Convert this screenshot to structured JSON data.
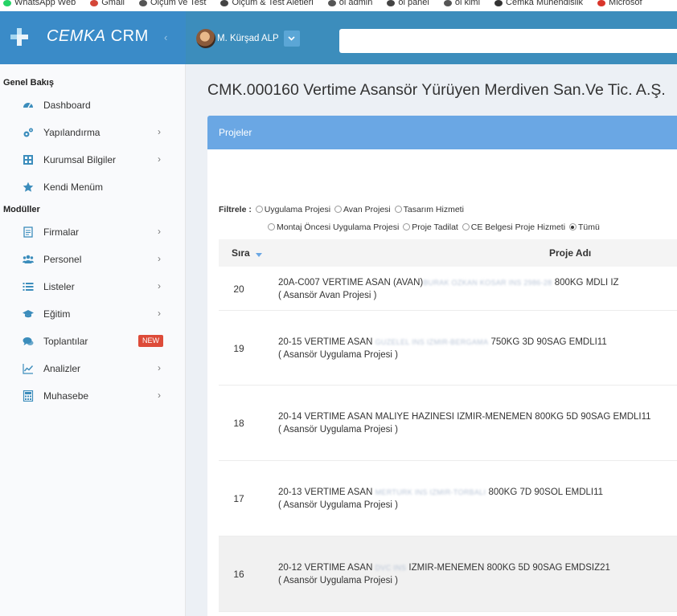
{
  "bookmarks": [
    {
      "label": "WhatsApp Web",
      "color": "#25d366"
    },
    {
      "label": "Gmail",
      "color": "#d44638"
    },
    {
      "label": "Ölçüm ve Test",
      "color": "#555555"
    },
    {
      "label": "Ölçüm & Test Aletleri",
      "color": "#444444"
    },
    {
      "label": "öl admin",
      "color": "#555555"
    },
    {
      "label": "öl panel",
      "color": "#444444"
    },
    {
      "label": "öl kimi",
      "color": "#555555"
    },
    {
      "label": "Cemka Mühendislik",
      "color": "#333333"
    },
    {
      "label": "Microsof",
      "color": "#d9352b"
    }
  ],
  "header": {
    "app_name_brand": "CEMKA",
    "app_name_suffix": "CRM",
    "collapse_icon": "chevron-left-icon",
    "user_name": "M. Kürşad ALP",
    "search_value": ""
  },
  "sidebar": {
    "sections": [
      {
        "title": "Genel Bakış",
        "items": [
          {
            "label": "Dashboard",
            "icon": "dashboard-icon",
            "chevron": false,
            "badge": ""
          },
          {
            "label": "Yapılandırma",
            "icon": "cogs-icon",
            "chevron": true,
            "badge": ""
          },
          {
            "label": "Kurumsal Bilgiler",
            "icon": "building-icon",
            "chevron": true,
            "badge": ""
          },
          {
            "label": "Kendi Menüm",
            "icon": "star-icon",
            "chevron": false,
            "badge": ""
          }
        ]
      },
      {
        "title": "Modüller",
        "items": [
          {
            "label": "Firmalar",
            "icon": "file-icon",
            "chevron": true,
            "badge": ""
          },
          {
            "label": "Personel",
            "icon": "users-icon",
            "chevron": true,
            "badge": ""
          },
          {
            "label": "Listeler",
            "icon": "list-icon",
            "chevron": true,
            "badge": ""
          },
          {
            "label": "Eğitim",
            "icon": "graduation-cap-icon",
            "chevron": true,
            "badge": ""
          },
          {
            "label": "Toplantılar",
            "icon": "comments-icon",
            "chevron": false,
            "badge": "NEW"
          },
          {
            "label": "Analizler",
            "icon": "line-chart-icon",
            "chevron": true,
            "badge": ""
          },
          {
            "label": "Muhasebe",
            "icon": "calculator-icon",
            "chevron": true,
            "badge": ""
          }
        ]
      }
    ]
  },
  "main": {
    "page_title": "CMK.000160 Vertime Asansör Yürüyen Merdiven San.Ve Tic. A.Ş.",
    "panel_title": "Projeler",
    "filter": {
      "label": "Filtrele :",
      "options": [
        {
          "label": "Uygulama Projesi",
          "checked": false
        },
        {
          "label": "Avan Projesi",
          "checked": false
        },
        {
          "label": "Tasarım Hizmeti",
          "checked": false
        },
        {
          "label": "Montaj Öncesi Uygulama Projesi",
          "checked": false
        },
        {
          "label": "Proje Tadilat",
          "checked": false
        },
        {
          "label": "CE Belgesi Proje Hizmeti",
          "checked": false
        },
        {
          "label": "Tümü",
          "checked": true
        }
      ]
    },
    "table": {
      "col_sira": "Sıra",
      "col_proje": "Proje Adı",
      "rows": [
        {
          "sira": "20",
          "name_pre": "20A-C007 VERTIME ASAN (AVAN)",
          "name_blur": "BURAK OZKAN KOSAR INS 2986-28",
          "name_post": " 800KG MDLI IZ",
          "type": "( Asansör Avan Projesi )"
        },
        {
          "sira": "19",
          "name_pre": "20-15 VERTIME ASAN ",
          "name_blur": "GUZELEL INS IZMIR-BERGAMA",
          "name_post": " 750KG 3D 90SAG EMDLI11",
          "type": "( Asansör Uygulama Projesi )"
        },
        {
          "sira": "18",
          "name_pre": "20-14 VERTIME ASAN MALIYE HAZINESI IZMIR-MENEMEN 800KG 5D 90SAG EMDLI11",
          "name_blur": "",
          "name_post": "",
          "type": "( Asansör Uygulama Projesi )"
        },
        {
          "sira": "17",
          "name_pre": "20-13 VERTIME ASAN ",
          "name_blur": "MERTURK INS IZMIR-TORBALI",
          "name_post": " 800KG 7D 90SOL EMDLI11",
          "type": "( Asansör Uygulama Projesi )"
        },
        {
          "sira": "16",
          "name_pre": "20-12 VERTIME ASAN ",
          "name_blur": "DVC INS",
          "name_post": " IZMIR-MENEMEN 800KG 5D 90SAG EMDSIZ21",
          "type": "( Asansör Uygulama Projesi )"
        }
      ]
    }
  }
}
